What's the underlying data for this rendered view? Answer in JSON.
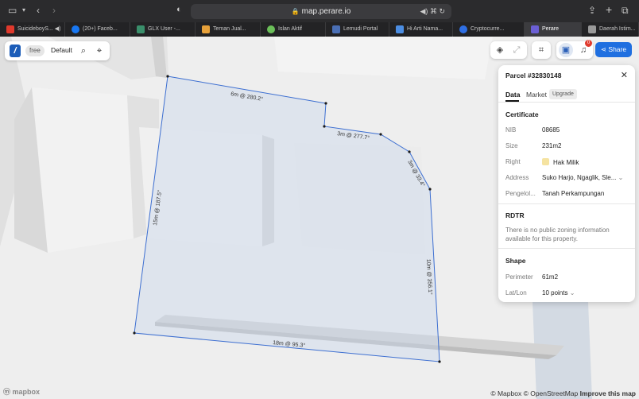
{
  "browser": {
    "url": "map.perare.io",
    "tabs": [
      {
        "label": "SuicideboyS...",
        "color": "#e0392c"
      },
      {
        "label": "(20+) Faceb...",
        "color": "#1877f2"
      },
      {
        "label": "GLX User -...",
        "color": "#3a8f6b"
      },
      {
        "label": "Teman Jual...",
        "color": "#e7a13a"
      },
      {
        "label": "Islan Aktif",
        "color": "#6bbf59"
      },
      {
        "label": "Lemudi Portal",
        "color": "#4a6fb5"
      },
      {
        "label": "Hi Arti Nama...",
        "color": "#4c8ee3"
      },
      {
        "label": "Cryptocurre...",
        "color": "#2f6fe4"
      },
      {
        "label": "Perare",
        "color": "#6b5fd4"
      },
      {
        "label": "Daerah Istim...",
        "color": "#999999"
      }
    ]
  },
  "toolbar": {
    "plan_badge": "free",
    "profile": "Default",
    "share_label": "Share",
    "notifications": "0"
  },
  "parcel": {
    "title": "Parcel #32830148",
    "tabs": {
      "data": "Data",
      "market": "Market",
      "upgrade": "Upgrade"
    },
    "certificate": {
      "title": "Certificate",
      "rows": [
        {
          "label": "NIB",
          "value": "08685"
        },
        {
          "label": "Size",
          "value": "231m2"
        },
        {
          "label": "Right",
          "value": "Hak Milik"
        },
        {
          "label": "Address",
          "value": "Suko Harjo, Ngaglik, Sle..."
        },
        {
          "label": "Pengelol...",
          "value": "Tanah Perkampungan"
        }
      ]
    },
    "rdtr": {
      "title": "RDTR",
      "note": "There is no public zoning information available for this property."
    },
    "shape": {
      "title": "Shape",
      "rows": [
        {
          "label": "Perimeter",
          "value": "61m2"
        },
        {
          "label": "Lat/Lon",
          "value": "10 points"
        }
      ]
    }
  },
  "map": {
    "edge_labels": [
      "6m @ 280.2°",
      "3m @ 277.7°",
      "3m @ 33.4°",
      "10m @ 356.1°",
      "18m @ 95.3°",
      "15m @ 187.5°"
    ]
  },
  "attribution": {
    "logo": "mapbox",
    "mapbox": "© Mapbox",
    "osm": "© OpenStreetMap",
    "improve": "Improve this map"
  }
}
